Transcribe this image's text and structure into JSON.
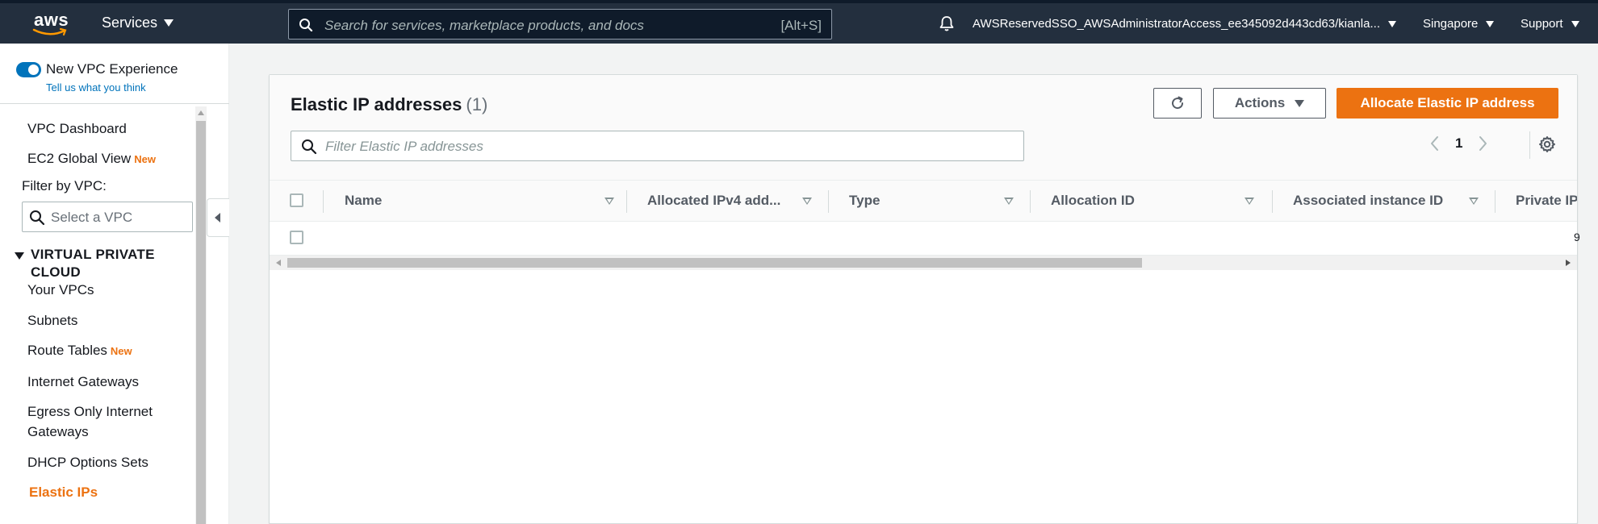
{
  "topnav": {
    "logo_text": "aws",
    "services_label": "Services",
    "search_placeholder": "Search for services, marketplace products, and docs",
    "search_shortcut": "[Alt+S]",
    "user_label": "AWSReservedSSO_AWSAdministratorAccess_ee345092d443cd63/kianla...",
    "region_label": "Singapore",
    "support_label": "Support"
  },
  "sidebar": {
    "new_vpc_toggle_label": "New VPC Experience",
    "feedback_link": "Tell us what you think",
    "top_items": [
      {
        "label": "VPC Dashboard",
        "badge": ""
      },
      {
        "label": "EC2 Global View",
        "badge": "New"
      }
    ],
    "filter_label": "Filter by VPC:",
    "filter_placeholder": "Select a VPC",
    "section_title": "VIRTUAL PRIVATE CLOUD",
    "section_items": [
      {
        "label": "Your VPCs",
        "badge": ""
      },
      {
        "label": "Subnets",
        "badge": ""
      },
      {
        "label": "Route Tables",
        "badge": "New"
      },
      {
        "label": "Internet Gateways",
        "badge": ""
      },
      {
        "label": "Egress Only Internet Gateways",
        "badge": ""
      },
      {
        "label": "DHCP Options Sets",
        "badge": ""
      },
      {
        "label": "Elastic IPs",
        "badge": "",
        "active": true
      }
    ]
  },
  "main": {
    "title": "Elastic IP addresses",
    "count": "(1)",
    "actions_label": "Actions",
    "primary_button_label": "Allocate Elastic IP address",
    "filter_placeholder": "Filter Elastic IP addresses",
    "current_page": "1",
    "columns": [
      "Name",
      "Allocated IPv4 add...",
      "Type",
      "Allocation ID",
      "Associated instance ID",
      "Private IP"
    ],
    "row_clip_text": "9"
  },
  "colors": {
    "nav_bg": "#232f3e",
    "accent_orange": "#ec7211",
    "link_blue": "#0073bb"
  },
  "icons": [
    "aws-logo",
    "search-icon",
    "bell-icon",
    "caret-down-icon",
    "refresh-icon",
    "chevron-left-icon",
    "chevron-right-icon",
    "gear-icon",
    "sort-icon"
  ]
}
